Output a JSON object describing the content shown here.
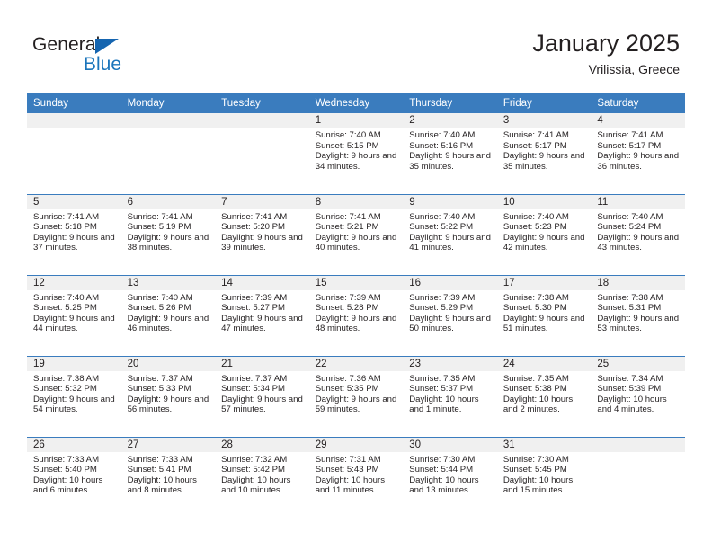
{
  "brand": {
    "name_top": "General",
    "name_bottom": "Blue",
    "triangle_color": "#1565b0",
    "blue_color": "#1b75bb"
  },
  "header": {
    "title": "January 2025",
    "location": "Vrilissia, Greece"
  },
  "theme": {
    "header_bg": "#3a7cbe",
    "header_text": "#ffffff",
    "daynum_bg": "#f0f0f0",
    "text": "#231f20"
  },
  "weekday_headers": [
    "Sunday",
    "Monday",
    "Tuesday",
    "Wednesday",
    "Thursday",
    "Friday",
    "Saturday"
  ],
  "weeks": [
    [
      {
        "day": "",
        "sunrise": "",
        "sunset": "",
        "daylight": "",
        "empty": true
      },
      {
        "day": "",
        "sunrise": "",
        "sunset": "",
        "daylight": "",
        "empty": true
      },
      {
        "day": "",
        "sunrise": "",
        "sunset": "",
        "daylight": "",
        "empty": true
      },
      {
        "day": "1",
        "sunrise": "Sunrise: 7:40 AM",
        "sunset": "Sunset: 5:15 PM",
        "daylight": "Daylight: 9 hours and 34 minutes."
      },
      {
        "day": "2",
        "sunrise": "Sunrise: 7:40 AM",
        "sunset": "Sunset: 5:16 PM",
        "daylight": "Daylight: 9 hours and 35 minutes."
      },
      {
        "day": "3",
        "sunrise": "Sunrise: 7:41 AM",
        "sunset": "Sunset: 5:17 PM",
        "daylight": "Daylight: 9 hours and 35 minutes."
      },
      {
        "day": "4",
        "sunrise": "Sunrise: 7:41 AM",
        "sunset": "Sunset: 5:17 PM",
        "daylight": "Daylight: 9 hours and 36 minutes."
      }
    ],
    [
      {
        "day": "5",
        "sunrise": "Sunrise: 7:41 AM",
        "sunset": "Sunset: 5:18 PM",
        "daylight": "Daylight: 9 hours and 37 minutes."
      },
      {
        "day": "6",
        "sunrise": "Sunrise: 7:41 AM",
        "sunset": "Sunset: 5:19 PM",
        "daylight": "Daylight: 9 hours and 38 minutes."
      },
      {
        "day": "7",
        "sunrise": "Sunrise: 7:41 AM",
        "sunset": "Sunset: 5:20 PM",
        "daylight": "Daylight: 9 hours and 39 minutes."
      },
      {
        "day": "8",
        "sunrise": "Sunrise: 7:41 AM",
        "sunset": "Sunset: 5:21 PM",
        "daylight": "Daylight: 9 hours and 40 minutes."
      },
      {
        "day": "9",
        "sunrise": "Sunrise: 7:40 AM",
        "sunset": "Sunset: 5:22 PM",
        "daylight": "Daylight: 9 hours and 41 minutes."
      },
      {
        "day": "10",
        "sunrise": "Sunrise: 7:40 AM",
        "sunset": "Sunset: 5:23 PM",
        "daylight": "Daylight: 9 hours and 42 minutes."
      },
      {
        "day": "11",
        "sunrise": "Sunrise: 7:40 AM",
        "sunset": "Sunset: 5:24 PM",
        "daylight": "Daylight: 9 hours and 43 minutes."
      }
    ],
    [
      {
        "day": "12",
        "sunrise": "Sunrise: 7:40 AM",
        "sunset": "Sunset: 5:25 PM",
        "daylight": "Daylight: 9 hours and 44 minutes."
      },
      {
        "day": "13",
        "sunrise": "Sunrise: 7:40 AM",
        "sunset": "Sunset: 5:26 PM",
        "daylight": "Daylight: 9 hours and 46 minutes."
      },
      {
        "day": "14",
        "sunrise": "Sunrise: 7:39 AM",
        "sunset": "Sunset: 5:27 PM",
        "daylight": "Daylight: 9 hours and 47 minutes."
      },
      {
        "day": "15",
        "sunrise": "Sunrise: 7:39 AM",
        "sunset": "Sunset: 5:28 PM",
        "daylight": "Daylight: 9 hours and 48 minutes."
      },
      {
        "day": "16",
        "sunrise": "Sunrise: 7:39 AM",
        "sunset": "Sunset: 5:29 PM",
        "daylight": "Daylight: 9 hours and 50 minutes."
      },
      {
        "day": "17",
        "sunrise": "Sunrise: 7:38 AM",
        "sunset": "Sunset: 5:30 PM",
        "daylight": "Daylight: 9 hours and 51 minutes."
      },
      {
        "day": "18",
        "sunrise": "Sunrise: 7:38 AM",
        "sunset": "Sunset: 5:31 PM",
        "daylight": "Daylight: 9 hours and 53 minutes."
      }
    ],
    [
      {
        "day": "19",
        "sunrise": "Sunrise: 7:38 AM",
        "sunset": "Sunset: 5:32 PM",
        "daylight": "Daylight: 9 hours and 54 minutes."
      },
      {
        "day": "20",
        "sunrise": "Sunrise: 7:37 AM",
        "sunset": "Sunset: 5:33 PM",
        "daylight": "Daylight: 9 hours and 56 minutes."
      },
      {
        "day": "21",
        "sunrise": "Sunrise: 7:37 AM",
        "sunset": "Sunset: 5:34 PM",
        "daylight": "Daylight: 9 hours and 57 minutes."
      },
      {
        "day": "22",
        "sunrise": "Sunrise: 7:36 AM",
        "sunset": "Sunset: 5:35 PM",
        "daylight": "Daylight: 9 hours and 59 minutes."
      },
      {
        "day": "23",
        "sunrise": "Sunrise: 7:35 AM",
        "sunset": "Sunset: 5:37 PM",
        "daylight": "Daylight: 10 hours and 1 minute."
      },
      {
        "day": "24",
        "sunrise": "Sunrise: 7:35 AM",
        "sunset": "Sunset: 5:38 PM",
        "daylight": "Daylight: 10 hours and 2 minutes."
      },
      {
        "day": "25",
        "sunrise": "Sunrise: 7:34 AM",
        "sunset": "Sunset: 5:39 PM",
        "daylight": "Daylight: 10 hours and 4 minutes."
      }
    ],
    [
      {
        "day": "26",
        "sunrise": "Sunrise: 7:33 AM",
        "sunset": "Sunset: 5:40 PM",
        "daylight": "Daylight: 10 hours and 6 minutes."
      },
      {
        "day": "27",
        "sunrise": "Sunrise: 7:33 AM",
        "sunset": "Sunset: 5:41 PM",
        "daylight": "Daylight: 10 hours and 8 minutes."
      },
      {
        "day": "28",
        "sunrise": "Sunrise: 7:32 AM",
        "sunset": "Sunset: 5:42 PM",
        "daylight": "Daylight: 10 hours and 10 minutes."
      },
      {
        "day": "29",
        "sunrise": "Sunrise: 7:31 AM",
        "sunset": "Sunset: 5:43 PM",
        "daylight": "Daylight: 10 hours and 11 minutes."
      },
      {
        "day": "30",
        "sunrise": "Sunrise: 7:30 AM",
        "sunset": "Sunset: 5:44 PM",
        "daylight": "Daylight: 10 hours and 13 minutes."
      },
      {
        "day": "31",
        "sunrise": "Sunrise: 7:30 AM",
        "sunset": "Sunset: 5:45 PM",
        "daylight": "Daylight: 10 hours and 15 minutes."
      },
      {
        "day": "",
        "sunrise": "",
        "sunset": "",
        "daylight": "",
        "empty": true
      }
    ]
  ]
}
